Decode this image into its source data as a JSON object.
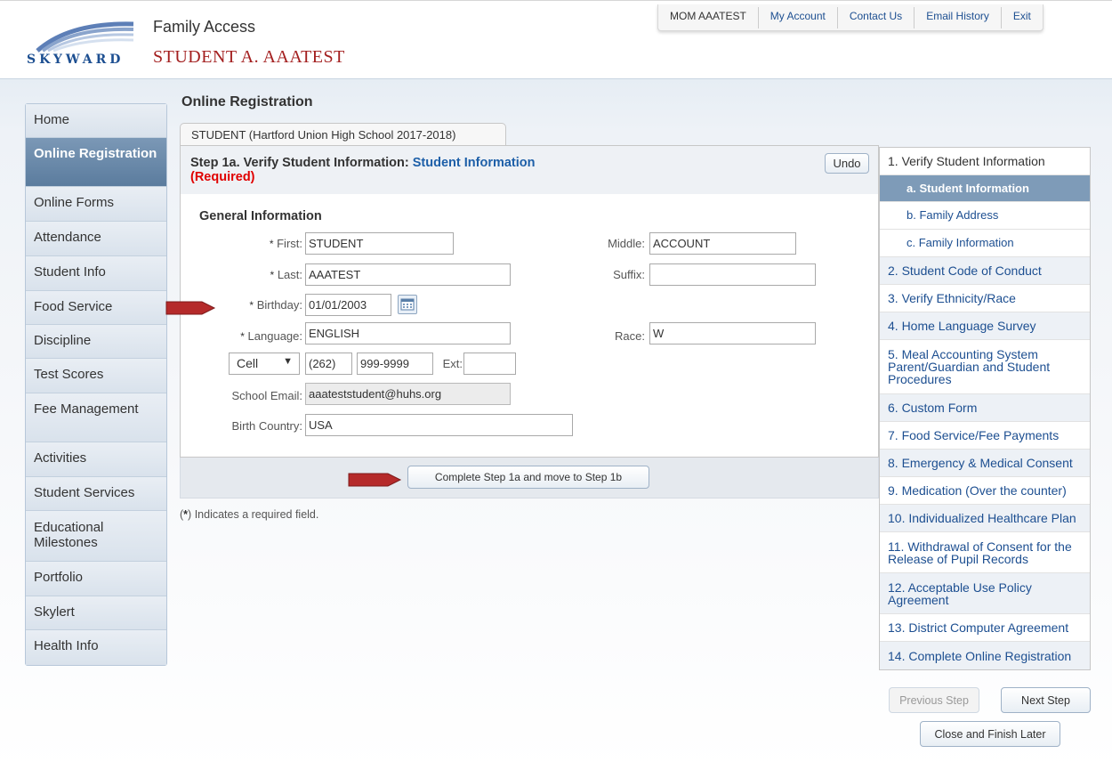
{
  "header": {
    "logo_text": "SKYWARD",
    "app_title": "Family Access",
    "student_name": "STUDENT A. AAATEST",
    "topnav": [
      "MOM AAATEST",
      "My Account",
      "Contact Us",
      "Email History",
      "Exit"
    ]
  },
  "sidebar": {
    "items": [
      "Home",
      "Online Registration",
      "Online Forms",
      "Attendance",
      "Student Info",
      "Food Service",
      "Discipline",
      "Test Scores",
      "Fee Management",
      "Activities",
      "Student Services",
      "Educational Milestones",
      "Portfolio",
      "Skylert",
      "Health Info"
    ],
    "active": "Online Registration"
  },
  "main": {
    "heading": "Online Registration",
    "tab_label": "STUDENT (Hartford Union High School 2017-2018)",
    "step_prefix": "Step 1a. Verify Student Information: ",
    "step_highlight": "Student Information",
    "required_label": "(Required)",
    "undo_label": "Undo",
    "section_title": "General Information",
    "fields": {
      "first": {
        "label": "First:",
        "value": "STUDENT",
        "required": "*"
      },
      "middle": {
        "label": "Middle:",
        "value": "ACCOUNT"
      },
      "last": {
        "label": "Last:",
        "value": "AAATEST",
        "required": "*"
      },
      "suffix": {
        "label": "Suffix:",
        "value": ""
      },
      "birthday": {
        "label": "Birthday:",
        "value": "01/01/2003",
        "required": "*"
      },
      "language": {
        "label": "Language:",
        "value": "ENGLISH",
        "required": "*"
      },
      "race": {
        "label": "Race:",
        "value": "W"
      },
      "phone_type": "Cell",
      "phone_area": "(262)",
      "phone_number": "999-9999",
      "ext_label": "Ext:",
      "ext_value": "",
      "school_email": {
        "label": "School Email:",
        "value": "aaateststudent@huhs.org"
      },
      "birth_country": {
        "label": "Birth Country:",
        "value": "USA"
      }
    },
    "complete_button": "Complete Step 1a and move to Step 1b",
    "required_note_star": "*",
    "required_note": " Indicates a required field."
  },
  "steps": [
    {
      "label": "1. Verify Student Information",
      "kind": "first"
    },
    {
      "label": "a. Student Information",
      "kind": "sub-active"
    },
    {
      "label": "b. Family Address",
      "kind": "sub"
    },
    {
      "label": "c. Family Information",
      "kind": "sub"
    },
    {
      "label": "2. Student Code of Conduct",
      "kind": "shade"
    },
    {
      "label": "3. Verify Ethnicity/Race",
      "kind": "plain"
    },
    {
      "label": "4. Home Language Survey",
      "kind": "shade"
    },
    {
      "label": "5. Meal Accounting System Parent/Guardian and Student Procedures",
      "kind": "plain"
    },
    {
      "label": "6. Custom Form",
      "kind": "shade"
    },
    {
      "label": "7. Food Service/Fee Payments",
      "kind": "plain"
    },
    {
      "label": "8. Emergency & Medical Consent",
      "kind": "shade"
    },
    {
      "label": "9. Medication (Over the counter)",
      "kind": "plain"
    },
    {
      "label": "10. Individualized Healthcare Plan",
      "kind": "shade"
    },
    {
      "label": "11. Withdrawal of Consent for the Release of Pupil Records",
      "kind": "plain"
    },
    {
      "label": "12. Acceptable Use Policy Agreement",
      "kind": "shade"
    },
    {
      "label": "13. District Computer Agreement",
      "kind": "plain"
    },
    {
      "label": "14. Complete Online Registration",
      "kind": "shade"
    }
  ],
  "buttons": {
    "previous": "Previous Step",
    "next": "Next Step",
    "close": "Close and Finish Later"
  },
  "colors": {
    "brand_blue": "#1d4f91",
    "student_name_red": "#a31f1f",
    "required_red": "#e00000",
    "arrow_red": "#b52a2a",
    "active_nav": "#5b7c9e"
  }
}
